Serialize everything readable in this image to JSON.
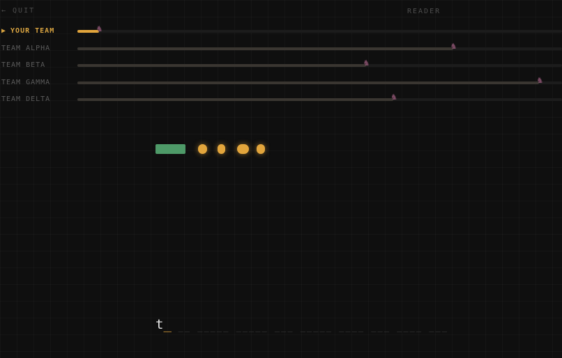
{
  "header": {
    "quit_label": "← QUIT",
    "mode_label": "READER"
  },
  "race": {
    "player_marker": "▶",
    "racer_icon": "horse-head-icon",
    "lanes": [
      {
        "label": "YOUR TEAM",
        "progress": 0.044,
        "is_player": true
      },
      {
        "label": "TEAM ALPHA",
        "progress": 0.775,
        "is_player": false
      },
      {
        "label": "TEAM BETA",
        "progress": 0.595,
        "is_player": false
      },
      {
        "label": "TEAM GAMMA",
        "progress": 0.953,
        "is_player": false
      },
      {
        "label": "TEAM DELTA",
        "progress": 0.652,
        "is_player": false
      }
    ]
  },
  "word_progress": {
    "completed_chunks": 1,
    "pending_chunks": 4,
    "colors": {
      "done": "#4e9a68",
      "pending": "#e2a53c"
    }
  },
  "typing": {
    "typed": "t",
    "cursor": "_",
    "remaining": "__ _____ _____ ___ _____ ____ ___ ____ ___"
  },
  "colors": {
    "background": "#0f0f0f",
    "accent": "#e2a53c",
    "racer": "#7a4a63"
  }
}
